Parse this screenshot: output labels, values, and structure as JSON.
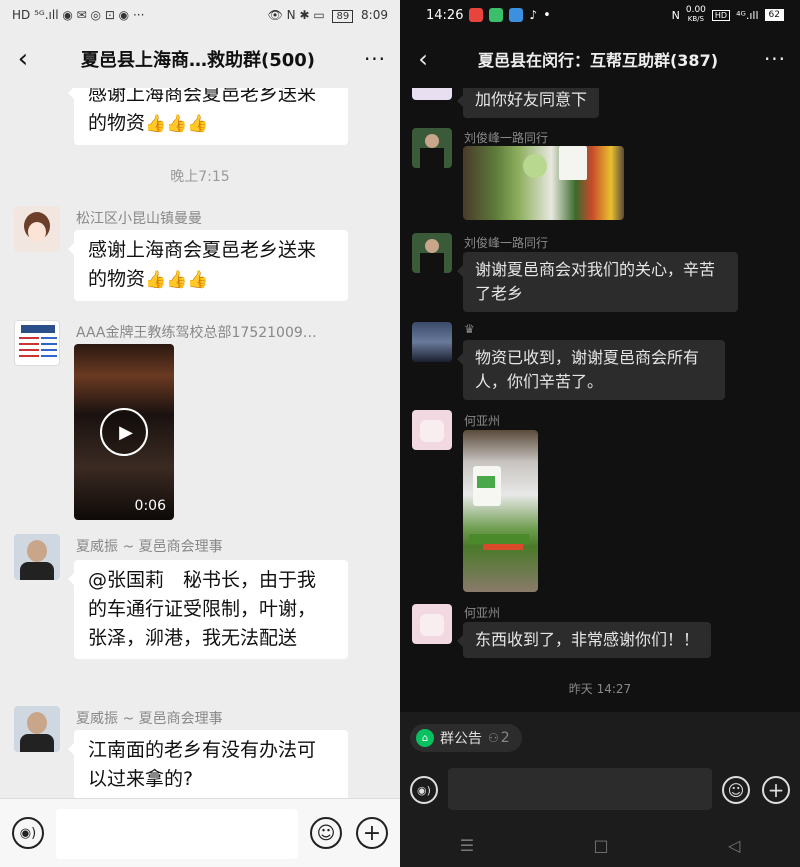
{
  "left": {
    "status": {
      "left_icons": "HD ⁵ᴳ.ıll ◉ ✉ ◎ ⊡ ◉ ···",
      "right_icons": "👁 N ✱ ▭",
      "battery": "89",
      "time": "8:09"
    },
    "title": "夏邑县上海商…救助群(500)",
    "messages": [
      {
        "text": "感谢上海商会夏邑老乡送来的物资"
      },
      {
        "name": "松江区小昆山镇曼曼",
        "text": "感谢上海商会夏邑老乡送来的物资"
      },
      {
        "name": "AAA金牌王教练驾校总部17521009…",
        "video_duration": "0:06"
      },
      {
        "name": "夏威振 ~ 夏邑商会理事",
        "text": "@张国莉　秘书长，由于我的车通行证受限制，叶谢，张泽，泖港，我无法配送"
      },
      {
        "name": "夏威振 ~ 夏邑商会理事",
        "text": "江南面的老乡有没有办法可以过来拿的?"
      }
    ],
    "time_divider": "晚上7:15",
    "emoji": "👍👍👍"
  },
  "right": {
    "status": {
      "time": "14:26",
      "speed_value": "0.00",
      "speed_unit": "KB/S",
      "battery": "62"
    },
    "title": "夏邑县在闵行：互帮互助群(387)",
    "messages": [
      {
        "text": "加你好友同意下"
      },
      {
        "name": "刘俊峰一路同行"
      },
      {
        "name": "刘俊峰一路同行",
        "text": "谢谢夏邑商会对我们的关心，辛苦了老乡"
      },
      {
        "name": "♛",
        "text": "物资已收到，谢谢夏邑商会所有人，你们辛苦了。"
      },
      {
        "name": "何亚州"
      },
      {
        "name": "何亚州",
        "text": "东西收到了，非常感谢你们！！"
      }
    ],
    "time_divider": "昨天 14:27",
    "announce_label": "群公告",
    "member_count": "2",
    "nav": {
      "menu": "☰",
      "home": "□",
      "back": "◁"
    }
  },
  "colors": {
    "wechat_bg": "#ededed",
    "dark_bg": "#111111",
    "green": "#07c160"
  }
}
